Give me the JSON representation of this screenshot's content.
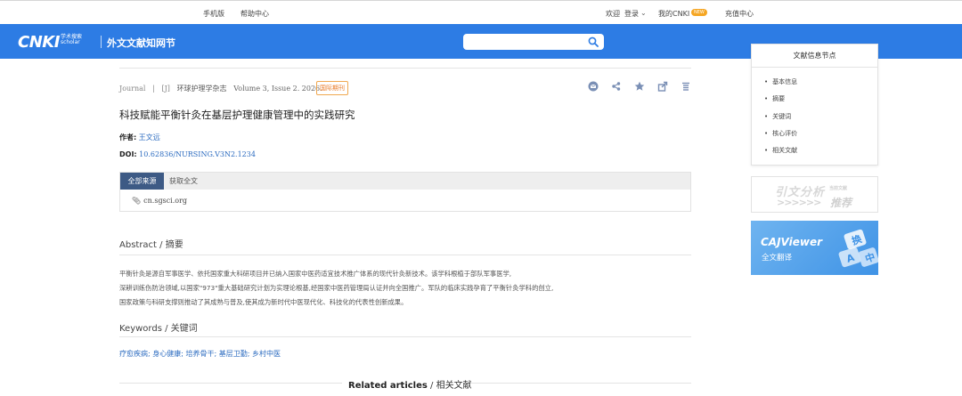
{
  "topbar": {
    "mobile": "手机版",
    "help": "帮助中心",
    "welcome": "欢迎",
    "login": "登录",
    "my_cnki": "我的CNKI",
    "new_badge": "NEW",
    "recharge": "充值中心"
  },
  "header": {
    "logo_main": "CNKI",
    "logo_sub_top": "学术搜索",
    "logo_sub_bottom": "scholar",
    "site_name": "外文文献知网节",
    "search_value": ""
  },
  "article": {
    "type": "Journal",
    "sep": "|",
    "code": "[J]",
    "journal": "环球护理学杂志",
    "volume": "Volume 3, Issue 2. 2026.",
    "badge": "国际期刊",
    "title": "科技赋能平衡针灸在基层护理健康管理中的实践研究",
    "author_label": "作者:",
    "author": "王文远",
    "doi_label": "DOI:",
    "doi": "10.62836/NURSING.V3N2.1234"
  },
  "source": {
    "tab_all": "全部来源",
    "tab_full": "获取全文",
    "link": "cn.sgsci.org"
  },
  "abstract": {
    "heading": "Abstract / 摘要",
    "lines": [
      "平衡针灸是源自军事医学、依托国家重大科研项目并已纳入国家中医药适宜技术推广体系的现代针灸新技术。该学科根植于部队军事医学,",
      "深耕训练伤防治领域,以国家\"973\"重大基础研究计划为实理论根基,经国家中医药管理局认证并向全国推广。军队的临床实践孕育了平衡针灸学科的创立,",
      "国家政策与科研支撑则推动了其成熟与普及,使其成为新时代中医现代化、科技化的代表性创新成果。"
    ]
  },
  "keywords": {
    "heading": "Keywords / 关键词",
    "text": "疗愈疾病; 身心健康; 培养骨干; 基层卫勤; 乡村中医"
  },
  "related": {
    "en": "Related articles",
    "zh": "/ 相关文献"
  },
  "sidebar": {
    "title": "文献信息节点",
    "items": [
      "基本信息",
      "摘要",
      "关键词",
      "核心评价",
      "相关文献"
    ]
  },
  "banners": {
    "analysis_main": "引文分析",
    "analysis_sub": "当前文献",
    "analysis_arrows": ">>>>>>",
    "analysis_rec": "推荐",
    "caj_title": "CAJViewer",
    "caj_sub": "全文翻译"
  },
  "colors": {
    "header_blue": "#2d7ce4",
    "link_blue": "#2d6cc0",
    "tab_navy": "#3d5a85",
    "badge_orange": "#e87722"
  }
}
